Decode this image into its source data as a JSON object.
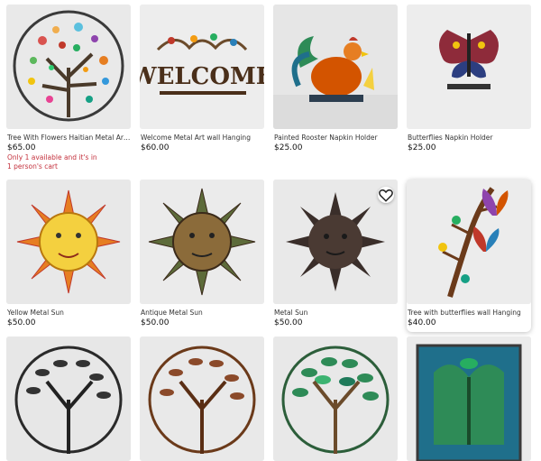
{
  "listings": [
    {
      "title": "Tree With Flowers Haitian Metal Art Wa...",
      "price": "$65.00",
      "note_line1": "Only 1 available and it's in",
      "note_line2": "1 person's cart",
      "image": "tree-with-flowers"
    },
    {
      "title": "Welcome Metal Art wall Hanging",
      "price": "$60.00",
      "image": "welcome-sign",
      "sign_text": "WELCOME"
    },
    {
      "title": "Painted Rooster Napkin Holder",
      "price": "$25.00",
      "image": "rooster"
    },
    {
      "title": "Butterflies Napkin Holder",
      "price": "$25.00",
      "image": "butterfly"
    },
    {
      "title": "Yellow Metal Sun",
      "price": "$50.00",
      "image": "yellow-sun"
    },
    {
      "title": "Antique Metal Sun",
      "price": "$50.00",
      "image": "antique-sun"
    },
    {
      "title": "Metal Sun",
      "price": "$50.00",
      "image": "dark-sun",
      "favorite_icon": "heart-icon"
    },
    {
      "title": "Tree with butterflies wall Hanging",
      "price": "$40.00",
      "image": "butterfly-tree"
    },
    {
      "image": "dark-tree"
    },
    {
      "image": "bronze-tree"
    },
    {
      "image": "green-tree"
    },
    {
      "image": "blue-panel"
    }
  ],
  "colors": {
    "note_red": "#c4323e",
    "card_bg": "#ececec"
  }
}
